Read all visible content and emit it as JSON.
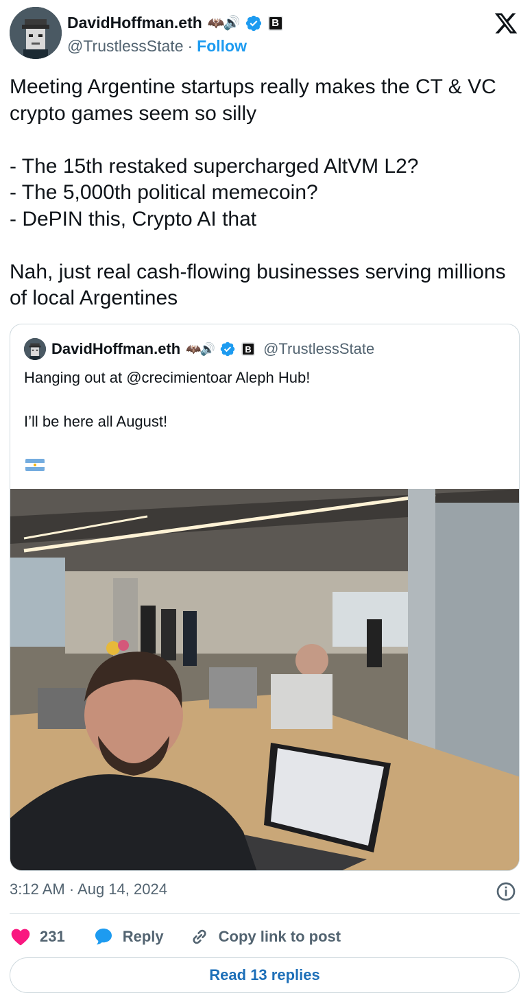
{
  "author": {
    "name": "DavidHoffman.eth",
    "emoji": "🦇🔊",
    "badge_letter": "B",
    "handle": "@TrustlessState",
    "follow_label": "Follow"
  },
  "tweet": {
    "text": "Meeting Argentine startups really makes the CT & VC crypto games seem so silly\n\n- The 15th restaked supercharged AltVM L2?\n- The 5,000th political memecoin?\n- DePIN this, Crypto AI that\n\nNah, just real cash-flowing businesses serving millions of local Argentines"
  },
  "quote": {
    "name": "DavidHoffman.eth",
    "emoji": "🦇🔊",
    "badge_letter": "B",
    "handle": "@TrustlessState",
    "text": "Hanging out at @crecimientoar Aleph Hub!\n\nI’ll be here all August!",
    "flag_icon": "argentina-flag-icon"
  },
  "meta": {
    "timestamp": "3:12 AM · Aug 14, 2024",
    "separator": "·"
  },
  "actions": {
    "like_count": "231",
    "reply_label": "Reply",
    "copy_label": "Copy link to post"
  },
  "replies_button": "Read 13 replies",
  "colors": {
    "accent": "#1d9bf0",
    "like": "#f91880",
    "text": "#0f1419",
    "muted": "#536471",
    "border": "#cfd9de"
  }
}
